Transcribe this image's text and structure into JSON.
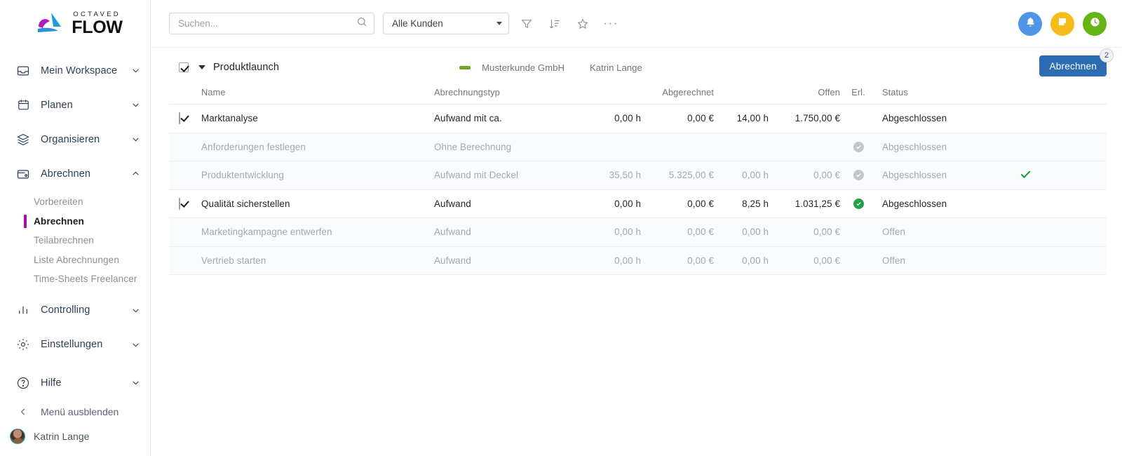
{
  "brand": {
    "top": "OCTAVED",
    "bottom": "FLOW"
  },
  "sidebar": {
    "items": [
      {
        "label": "Mein Workspace",
        "icon": "inbox-icon",
        "expanded": false
      },
      {
        "label": "Planen",
        "icon": "calendar-icon",
        "expanded": false
      },
      {
        "label": "Organisieren",
        "icon": "layers-icon",
        "expanded": false
      },
      {
        "label": "Abrechnen",
        "icon": "wallet-icon",
        "expanded": true
      },
      {
        "label": "Controlling",
        "icon": "bar-chart-icon",
        "expanded": false
      },
      {
        "label": "Einstellungen",
        "icon": "gear-icon",
        "expanded": false
      },
      {
        "label": "Hilfe",
        "icon": "question-circle-icon",
        "expanded": false
      }
    ],
    "subitems": [
      {
        "label": "Vorbereiten",
        "active": false
      },
      {
        "label": "Abrechnen",
        "active": true
      },
      {
        "label": "Teilabrechnen",
        "active": false
      },
      {
        "label": "Liste Abrechnungen",
        "active": false
      },
      {
        "label": "Time-Sheets Freelancer",
        "active": false
      }
    ],
    "collapse_label": "Menü ausblenden",
    "user_name": "Katrin Lange",
    "active_accent": "#a50ea5"
  },
  "toolbar": {
    "search_placeholder": "Suchen...",
    "search_value": "",
    "customer_filter": "Alle Kunden",
    "icons": [
      "filter-icon",
      "sort-icon",
      "star-icon",
      "more-icon"
    ],
    "actions": [
      {
        "name": "notifications-button",
        "icon": "bell-icon",
        "color": "#4f95e8"
      },
      {
        "name": "notes-button",
        "icon": "note-icon",
        "color": "#f5bd1a"
      },
      {
        "name": "time-tracking-button",
        "icon": "clock-icon",
        "color": "#65b517"
      }
    ]
  },
  "project": {
    "name": "Produktlaunch",
    "checked": true,
    "status_color": "#6fa81c",
    "client": "Musterkunde GmbH",
    "owner": "Katrin Lange",
    "bill_button": "Abrechnen",
    "bill_badge": "2"
  },
  "table": {
    "headers": {
      "name": "Name",
      "type": "Abrechnungstyp",
      "billed": "Abgerechnet",
      "open": "Offen",
      "done": "Erl.",
      "status": "Status"
    },
    "rows": [
      {
        "name": "Marktanalyse",
        "type": "Aufwand mit ca.",
        "billed_h": "0,00 h",
        "billed_e": "0,00 €",
        "open_h": "14,00 h",
        "open_e": "1.750,00 €",
        "erl": "none",
        "status": "Abgeschlossen",
        "checkbox": true,
        "dim": false,
        "extra": ""
      },
      {
        "name": "Anforderungen festlegen",
        "type": "Ohne Berechnung",
        "billed_h": "",
        "billed_e": "",
        "open_h": "",
        "open_e": "",
        "erl": "grey",
        "status": "Abgeschlossen",
        "checkbox": false,
        "dim": true,
        "extra": ""
      },
      {
        "name": "Produktentwicklung",
        "type": "Aufwand mit Deckel",
        "billed_h": "35,50 h",
        "billed_e": "5.325,00 €",
        "open_h": "0,00 h",
        "open_e": "0,00 €",
        "erl": "grey",
        "status": "Abgeschlossen",
        "checkbox": false,
        "dim": true,
        "extra": "check"
      },
      {
        "name": "Qualität sicherstellen",
        "type": "Aufwand",
        "billed_h": "0,00 h",
        "billed_e": "0,00 €",
        "open_h": "8,25 h",
        "open_e": "1.031,25 €",
        "erl": "green",
        "status": "Abgeschlossen",
        "checkbox": true,
        "dim": false,
        "extra": ""
      },
      {
        "name": "Marketingkampagne entwerfen",
        "type": "Aufwand",
        "billed_h": "0,00 h",
        "billed_e": "0,00 €",
        "open_h": "0,00 h",
        "open_e": "0,00 €",
        "erl": "none",
        "status": "Offen",
        "checkbox": false,
        "dim": true,
        "extra": ""
      },
      {
        "name": "Vertrieb starten",
        "type": "Aufwand",
        "billed_h": "0,00 h",
        "billed_e": "0,00 €",
        "open_h": "0,00 h",
        "open_e": "0,00 €",
        "erl": "none",
        "status": "Offen",
        "checkbox": false,
        "dim": true,
        "extra": ""
      }
    ]
  }
}
